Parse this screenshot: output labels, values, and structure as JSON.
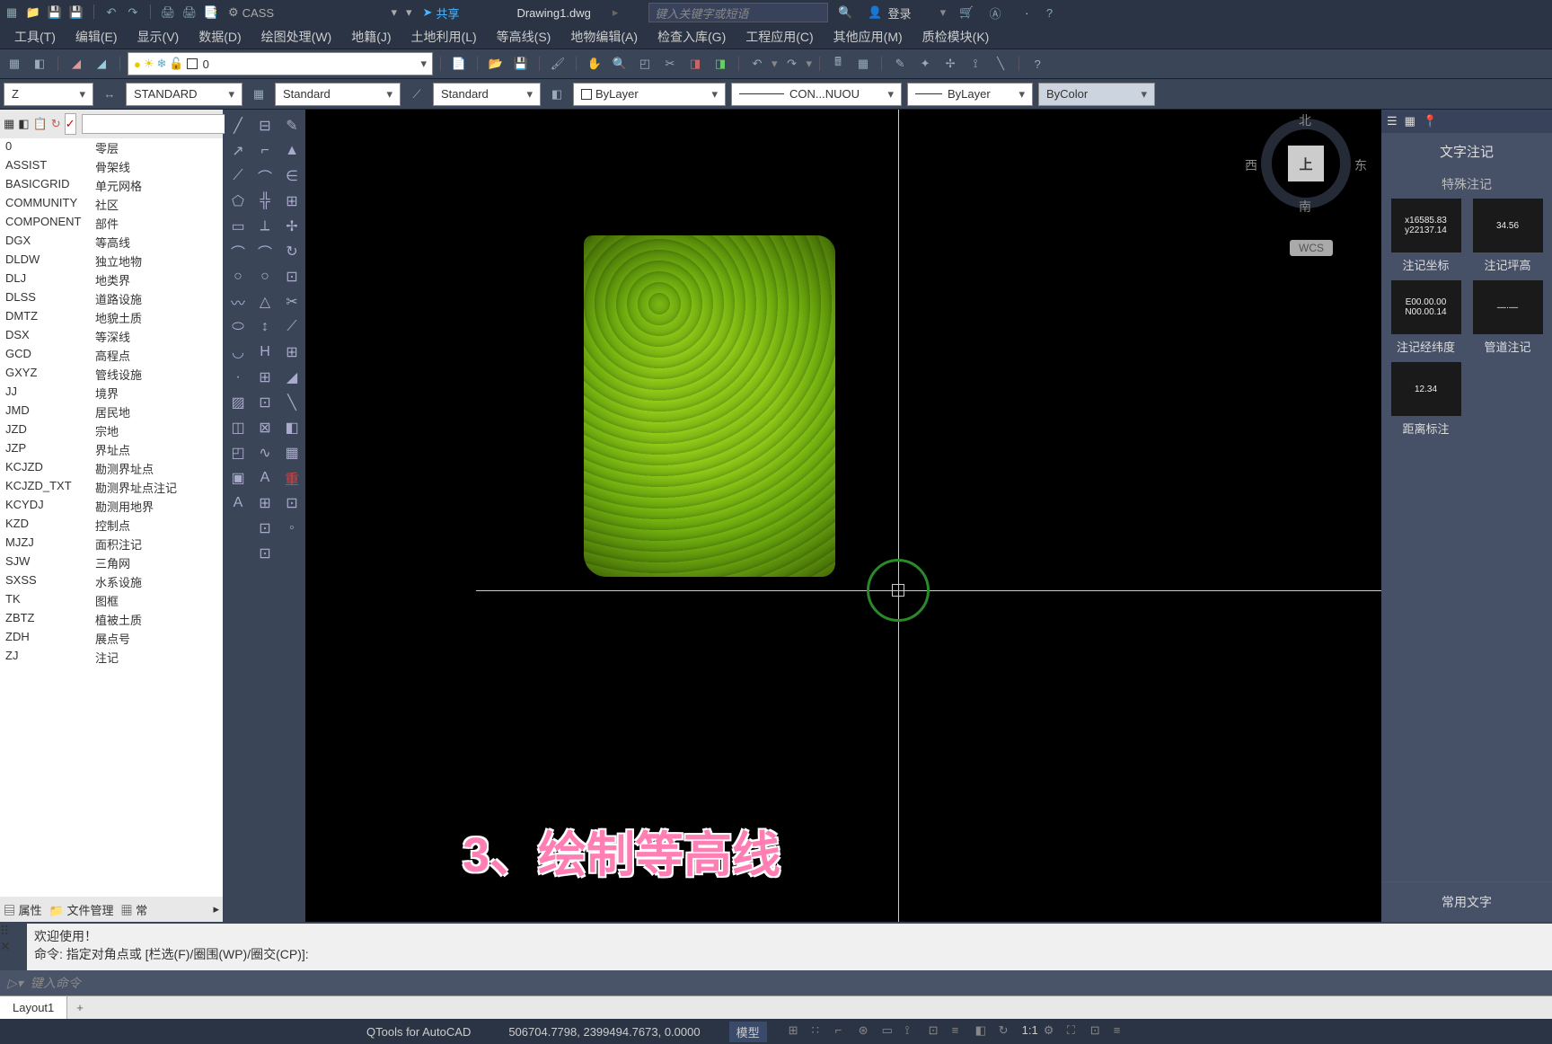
{
  "top": {
    "workspace": "CASS",
    "share": "共享",
    "filename": "Drawing1.dwg",
    "searchPlaceholder": "键入关键字或短语",
    "login": "登录"
  },
  "menus": [
    "工具(T)",
    "编辑(E)",
    "显示(V)",
    "数据(D)",
    "绘图处理(W)",
    "地籍(J)",
    "土地利用(L)",
    "等高线(S)",
    "地物编辑(A)",
    "检查入库(G)",
    "工程应用(C)",
    "其他应用(M)",
    "质检模块(K)"
  ],
  "layer": {
    "current": "0"
  },
  "styles": {
    "s1": "STANDARD",
    "s2": "Standard",
    "s3": "Standard",
    "s4": "ByLayer",
    "s5": "CON...NUOU",
    "s6": "ByLayer",
    "s7": "ByColor"
  },
  "layers": [
    {
      "c": "0",
      "n": "零层"
    },
    {
      "c": "ASSIST",
      "n": "骨架线"
    },
    {
      "c": "BASICGRID",
      "n": "单元网格"
    },
    {
      "c": "COMMUNITY",
      "n": "社区"
    },
    {
      "c": "COMPONENT",
      "n": "部件"
    },
    {
      "c": "DGX",
      "n": "等高线"
    },
    {
      "c": "DLDW",
      "n": "独立地物"
    },
    {
      "c": "DLJ",
      "n": "地类界"
    },
    {
      "c": "DLSS",
      "n": "道路设施"
    },
    {
      "c": "DMTZ",
      "n": "地貌土质"
    },
    {
      "c": "DSX",
      "n": "等深线"
    },
    {
      "c": "GCD",
      "n": "高程点"
    },
    {
      "c": "GXYZ",
      "n": "管线设施"
    },
    {
      "c": "JJ",
      "n": "境界"
    },
    {
      "c": "JMD",
      "n": "居民地"
    },
    {
      "c": "JZD",
      "n": "宗地"
    },
    {
      "c": "JZP",
      "n": "界址点"
    },
    {
      "c": "KCJZD",
      "n": "勘测界址点"
    },
    {
      "c": "KCJZD_TXT",
      "n": "勘测界址点注记"
    },
    {
      "c": "KCYDJ",
      "n": "勘测用地界"
    },
    {
      "c": "KZD",
      "n": "控制点"
    },
    {
      "c": "MJZJ",
      "n": "面积注记"
    },
    {
      "c": "SJW",
      "n": "三角网"
    },
    {
      "c": "SXSS",
      "n": "水系设施"
    },
    {
      "c": "TK",
      "n": "图框"
    },
    {
      "c": "ZBTZ",
      "n": "植被土质"
    },
    {
      "c": "ZDH",
      "n": "展点号"
    },
    {
      "c": "ZJ",
      "n": "注记"
    }
  ],
  "lpBottom": {
    "attr": "属性",
    "file": "文件管理",
    "common": "常"
  },
  "viewcube": {
    "top": "上",
    "n": "北",
    "s": "南",
    "e": "东",
    "w": "西",
    "wcs": "WCS"
  },
  "overlay": "3、绘制等高线",
  "rp": {
    "title": "文字注记",
    "sub": "特殊注记",
    "items": [
      {
        "thumb": "x16585.83\ny22137.14",
        "label": "注记坐标"
      },
      {
        "thumb": "34.56",
        "label": "注记坪高"
      },
      {
        "thumb": "E00.00.00\nN00.00.14",
        "label": "注记经纬度"
      },
      {
        "thumb": "—·—",
        "label": "管道注记"
      },
      {
        "thumb": "12.34",
        "label": "距离标注"
      }
    ],
    "common": "常用文字"
  },
  "cmd": {
    "welcome": "欢迎使用！",
    "line": "命令: 指定对角点或 [栏选(F)/圈围(WP)/圈交(CP)]:",
    "placeholder": "键入命令"
  },
  "tabs": {
    "layout": "Layout1"
  },
  "status": {
    "tool": "QTools for AutoCAD",
    "coords": "506704.7798, 2399494.7673, 0.0000",
    "model": "模型",
    "scale": "1:1"
  }
}
